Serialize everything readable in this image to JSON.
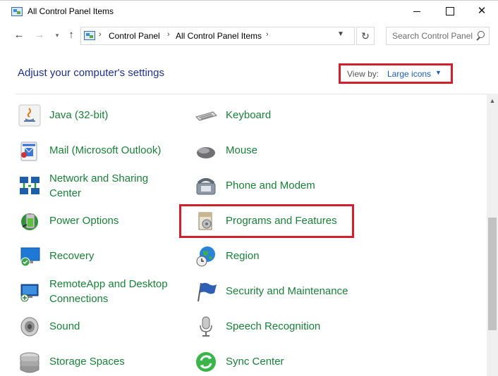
{
  "window": {
    "title": "All Control Panel Items"
  },
  "address_bar": {
    "breadcrumbs": [
      "Control Panel",
      "All Control Panel Items"
    ],
    "search_placeholder": "Search Control Panel"
  },
  "header": {
    "title": "Adjust your computer's settings",
    "view_by_label": "View by:",
    "view_by_value": "Large icons"
  },
  "items": [
    {
      "label": "Java (32-bit)",
      "icon": "java-icon"
    },
    {
      "label": "Keyboard",
      "icon": "keyboard-icon"
    },
    {
      "label": "Mail (Microsoft Outlook)",
      "icon": "mail-icon"
    },
    {
      "label": "Mouse",
      "icon": "mouse-icon"
    },
    {
      "label": "Network and Sharing Center",
      "icon": "network-icon"
    },
    {
      "label": "Phone and Modem",
      "icon": "phone-icon"
    },
    {
      "label": "Power Options",
      "icon": "power-icon"
    },
    {
      "label": "Programs and Features",
      "icon": "programs-icon"
    },
    {
      "label": "Recovery",
      "icon": "recovery-icon"
    },
    {
      "label": "Region",
      "icon": "region-icon"
    },
    {
      "label": "RemoteApp and Desktop Connections",
      "icon": "remoteapp-icon"
    },
    {
      "label": "Security and Maintenance",
      "icon": "security-flag-icon"
    },
    {
      "label": "Sound",
      "icon": "speaker-icon"
    },
    {
      "label": "Speech Recognition",
      "icon": "microphone-icon"
    },
    {
      "label": "Storage Spaces",
      "icon": "storage-icon"
    },
    {
      "label": "Sync Center",
      "icon": "sync-icon"
    }
  ],
  "colors": {
    "item_text": "#1a7f37",
    "heading_text": "#1e3287",
    "link_text": "#1a5fb4",
    "highlight_box": "#d0202e"
  }
}
